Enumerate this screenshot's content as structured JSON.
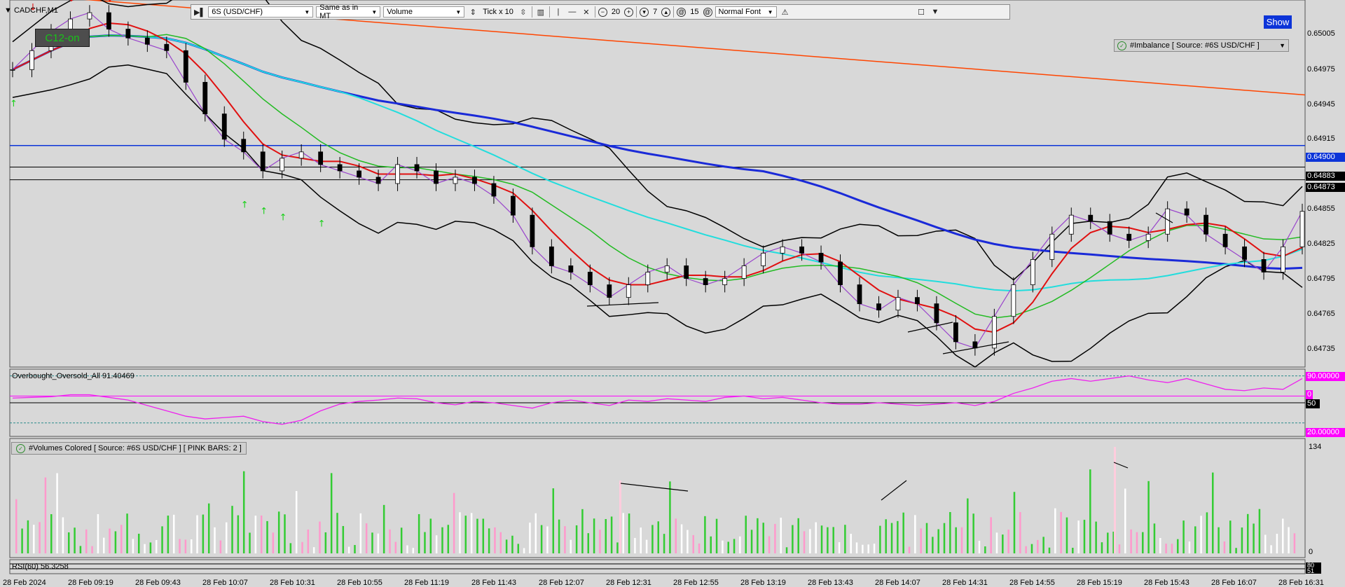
{
  "chart_title": "CADCHF,M1",
  "toolbar": {
    "symbol": "6S (USD/CHF)",
    "time_mode": "Same as in MT",
    "source": "Volume",
    "tick_mult": "Tick x 10",
    "stepper1": "20",
    "stepper2": "7",
    "stepper3": "15",
    "font_mode": "Normal Font"
  },
  "c12_label": "C12-on",
  "show_button": "Show",
  "imbalance_label": "#Imbalance [ Source: #6S USD/CHF ]",
  "obos": {
    "label": "Overbought_Oversold_All 91.40469",
    "tag_upper": "90.00000",
    "tag_mid_a": "0",
    "tag_mid_b": "50",
    "tag_lower": "20.00000"
  },
  "volumes": {
    "label": "#Volumes Colored [ Source: #6S USD/CHF ]  [ PINK BARS: 2 ]",
    "axis_top": "134",
    "axis_bottom": "0"
  },
  "rsi": {
    "label": "RSI(60) 56.3258",
    "tag_a": "80",
    "tag_b": "51"
  },
  "price_axis": {
    "ticks": [
      "0.65005",
      "0.64975",
      "0.64945",
      "0.64915",
      "0.64855",
      "0.64825",
      "0.64795",
      "0.64765",
      "0.64735"
    ],
    "tag_blue": "0.64900",
    "tag_1": "0.64883",
    "tag_2": "0.64873"
  },
  "time_axis": [
    "28 Feb 2024",
    "28 Feb 09:19",
    "28 Feb 09:43",
    "28 Feb 10:07",
    "28 Feb 10:31",
    "28 Feb 10:55",
    "28 Feb 11:19",
    "28 Feb 11:43",
    "28 Feb 12:07",
    "28 Feb 12:31",
    "28 Feb 12:55",
    "28 Feb 13:19",
    "28 Feb 13:43",
    "28 Feb 14:07",
    "28 Feb 14:31",
    "28 Feb 14:55",
    "28 Feb 15:19",
    "28 Feb 15:43",
    "28 Feb 16:07",
    "28 Feb 16:31"
  ],
  "chart_data": {
    "type": "line",
    "title": "CADCHF,M1",
    "ylim": [
      0.64725,
      0.65015
    ],
    "series": [
      {
        "name": "close",
        "values": [
          0.6496,
          0.64975,
          0.6499,
          0.65,
          0.65005,
          0.64992,
          0.64985,
          0.6498,
          0.64975,
          0.6495,
          0.64925,
          0.64905,
          0.64895,
          0.6488,
          0.6489,
          0.64895,
          0.64885,
          0.6488,
          0.64875,
          0.6487,
          0.64885,
          0.6488,
          0.6487,
          0.64875,
          0.6487,
          0.6486,
          0.64845,
          0.6482,
          0.64805,
          0.648,
          0.6479,
          0.6478,
          0.6479,
          0.648,
          0.64805,
          0.64795,
          0.6479,
          0.64795,
          0.64805,
          0.64815,
          0.6482,
          0.64815,
          0.64808,
          0.6479,
          0.64775,
          0.6477,
          0.6478,
          0.64775,
          0.6476,
          0.64745,
          0.6474,
          0.64765,
          0.6479,
          0.6481,
          0.6483,
          0.64845,
          0.6484,
          0.6483,
          0.64825,
          0.6483,
          0.6485,
          0.64845,
          0.6483,
          0.6482,
          0.6481,
          0.648,
          0.6482,
          0.64848
        ]
      }
    ],
    "obos_ylim": [
      0,
      100
    ],
    "obos_levels": [
      90,
      50,
      20
    ],
    "obos_values": [
      57,
      58,
      59,
      62,
      62,
      58,
      54,
      46,
      38,
      30,
      26,
      28,
      30,
      22,
      18,
      24,
      38,
      48,
      52,
      54,
      57,
      56,
      50,
      47,
      52,
      50,
      46,
      42,
      50,
      54,
      50,
      46,
      54,
      52,
      56,
      54,
      52,
      58,
      60,
      56,
      58,
      54,
      50,
      48,
      48,
      50,
      48,
      46,
      48,
      50,
      46,
      52,
      64,
      72,
      82,
      86,
      82,
      86,
      90,
      84,
      80,
      86,
      78,
      70,
      68,
      72,
      70,
      86
    ],
    "volume_ylim": [
      0,
      134
    ],
    "volume_max": 134,
    "pink_bars": 2
  }
}
